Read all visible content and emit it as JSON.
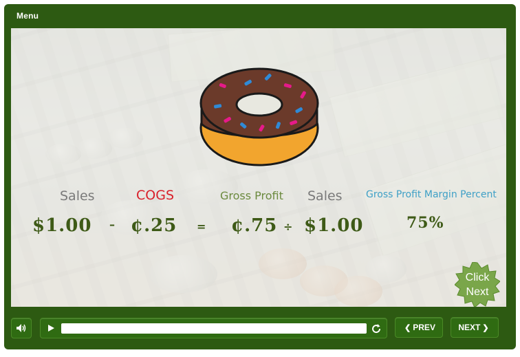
{
  "header": {
    "menu_label": "Menu"
  },
  "slide": {
    "labels": {
      "sales_1": "Sales",
      "cogs": "COGS",
      "gross_profit": "Gross Profit",
      "sales_2": "Sales",
      "gross_profit_margin_percent": "Gross Profit Margin Percent"
    },
    "values": {
      "sales_1": "$1.00",
      "cogs": "¢.25",
      "gross_profit": "¢.75",
      "sales_2": "$1.00",
      "percent": "75%"
    },
    "operators": {
      "minus": "–",
      "equals": "=",
      "divide": "÷"
    },
    "click_next": {
      "line1": "Click",
      "line2": "Next"
    }
  },
  "controls": {
    "prev_label": "PREV",
    "next_label": "NEXT",
    "progress_fraction": 0.0
  },
  "colors": {
    "frame": "#2d5a12",
    "value_green": "#3e5a17",
    "cogs_red": "#d9202a",
    "gpm_blue": "#3fa0c6",
    "gross_profit_green": "#6b8a3e",
    "donut_frosting": "#6b3a2a",
    "donut_dough": "#f2a52e"
  },
  "icons": [
    "volume-icon",
    "play-icon",
    "replay-icon",
    "chevron-left-icon",
    "chevron-right-icon",
    "donut-image",
    "starburst-badge"
  ]
}
